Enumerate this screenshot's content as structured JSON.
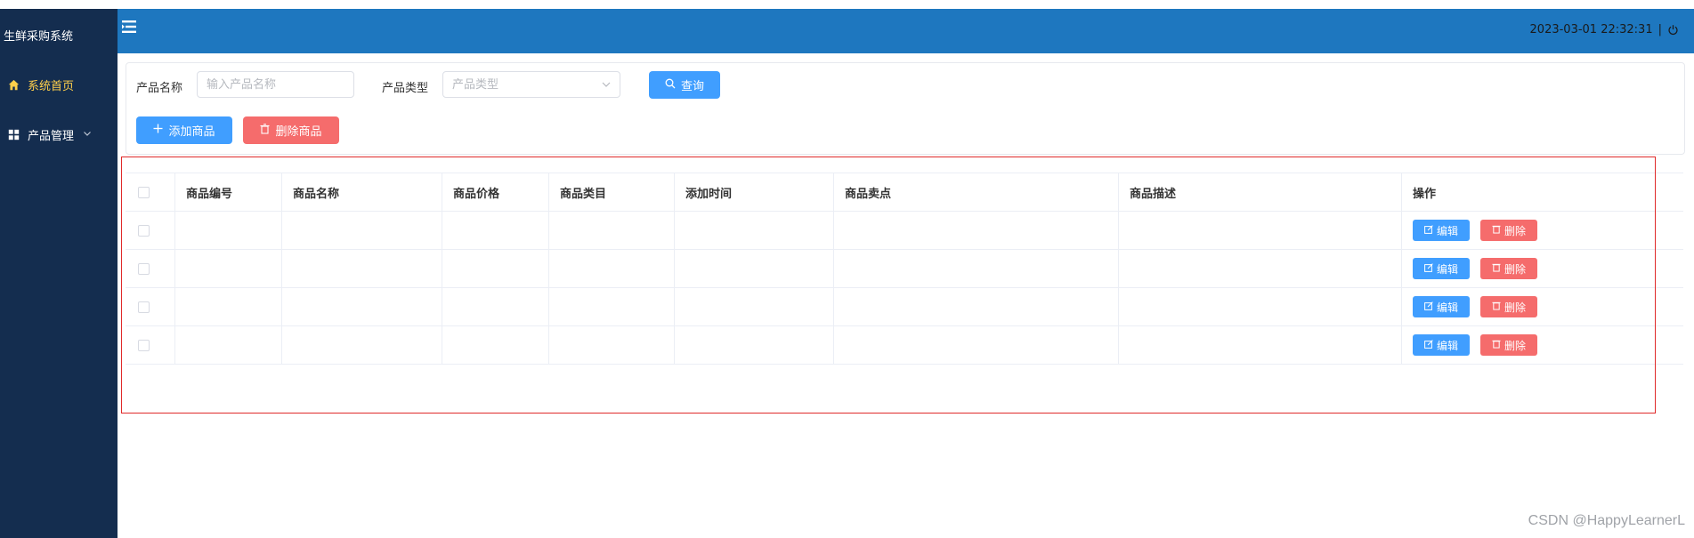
{
  "app": {
    "title": "生鲜采购系统"
  },
  "sidebar": {
    "items": [
      {
        "label": "系统首页",
        "icon": "home-icon",
        "active": true
      },
      {
        "label": "产品管理",
        "icon": "grid-icon",
        "expandable": true
      }
    ]
  },
  "header": {
    "datetime": "2023-03-01 22:32:31",
    "separator": "|"
  },
  "search": {
    "name_label": "产品名称",
    "name_placeholder": "输入产品名称",
    "type_label": "产品类型",
    "type_placeholder": "产品类型",
    "query_label": "查询"
  },
  "actions": {
    "add_label": "添加商品",
    "delete_label": "删除商品"
  },
  "table": {
    "columns": [
      "商品编号",
      "商品名称",
      "商品价格",
      "商品类目",
      "添加时间",
      "商品卖点",
      "商品描述",
      "操作"
    ],
    "row_actions": {
      "edit_label": "编辑",
      "delete_label": "删除"
    },
    "row_count": 4
  },
  "watermark": "CSDN @HappyLearnerL",
  "colors": {
    "sidebar_bg": "#142d4f",
    "header_bg": "#1e77bf",
    "active_menu": "#ffd04b",
    "primary": "#409eff",
    "danger": "#f56c6c",
    "annotation_border": "#e02a2a"
  }
}
